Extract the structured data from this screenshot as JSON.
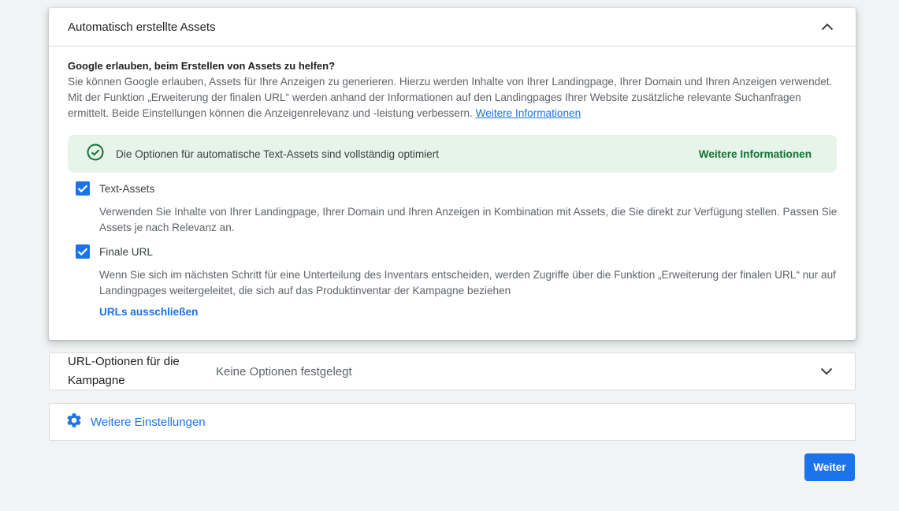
{
  "auto_assets": {
    "title": "Automatisch erstellte Assets",
    "question_title": "Google erlauben, beim Erstellen von Assets zu helfen?",
    "question_desc": "Sie können Google erlauben, Assets für Ihre Anzeigen zu generieren. Hierzu werden Inhalte von Ihrer Landingpage, Ihrer Domain und Ihren Anzeigen verwendet. Mit der Funktion „Erweiterung der finalen URL“ werden anhand der Informationen auf den Landingpages Ihrer Website zusätzliche relevante Suchanfragen ermittelt. Beide Einstellungen können die Anzeigenrelevanz und -leistung verbessern.",
    "learn_more_link": "Weitere Informationen",
    "banner": {
      "text": "Die Optionen für automatische Text-Assets sind vollständig optimiert",
      "link": "Weitere Informationen"
    },
    "options": [
      {
        "label": "Text-Assets",
        "checked": true,
        "description": "Verwenden Sie Inhalte von Ihrer Landingpage, Ihrer Domain und Ihren Anzeigen in Kombination mit Assets, die Sie direkt zur Verfügung stellen. Passen Sie Assets je nach Relevanz an."
      },
      {
        "label": "Finale URL",
        "checked": true,
        "description": "Wenn Sie sich im nächsten Schritt für eine Unterteilung des Inventars entscheiden, werden Zugriffe über die Funktion „Erweiterung der finalen URL“ nur auf Landingpages weitergeleitet, die sich auf das Produktinventar der Kampagne beziehen"
      }
    ],
    "exclude_urls_link": "URLs ausschließen"
  },
  "url_options": {
    "title": "URL-Optionen für die Kampagne",
    "value": "Keine Optionen festgelegt"
  },
  "more_settings": {
    "label": "Weitere Einstellungen"
  },
  "next_button": "Weiter",
  "colors": {
    "accent": "#1a73e8",
    "success_bg": "#e6f4ea",
    "success_text": "#137333",
    "page_bg": "#f1f3f4"
  },
  "icons": {
    "collapse": "chevron-up-icon",
    "expand": "chevron-down-icon",
    "status": "check-circle-icon",
    "settings": "gear-icon"
  }
}
